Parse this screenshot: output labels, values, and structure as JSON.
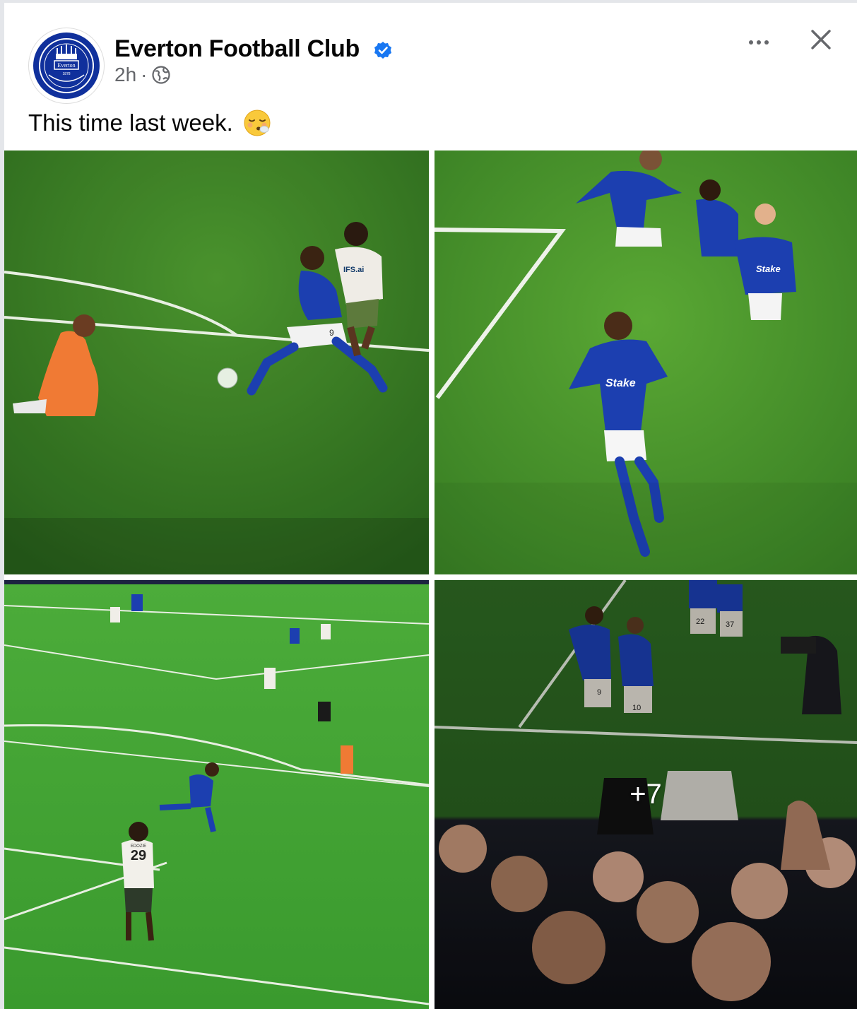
{
  "post": {
    "page_name": "Everton Football Club",
    "time": "2h",
    "separator": "·",
    "privacy_icon": "globe-icon",
    "verified_icon": "verified-badge-icon",
    "text": "This time last week.",
    "emoji": "face-exhaling-emoji",
    "more_icon": "more-options-icon",
    "close_icon": "close-icon"
  },
  "avatar": {
    "logo_text": "Everton",
    "year": "1878"
  },
  "photos": {
    "p1_label_number": "9",
    "p1_sponsor": "IFS.ai",
    "p2_sponsor": "Stake",
    "p3_shirt_number": "29",
    "p3_shirt_name": "EDOZIE",
    "p4_numbers": [
      "9",
      "10",
      "22",
      "37"
    ],
    "more_count": "+7"
  },
  "colors": {
    "everton_blue": "#10309c",
    "pitch_green": "#3f8c2c",
    "verified_blue": "#1877f2",
    "meta_gray": "#65676b"
  }
}
